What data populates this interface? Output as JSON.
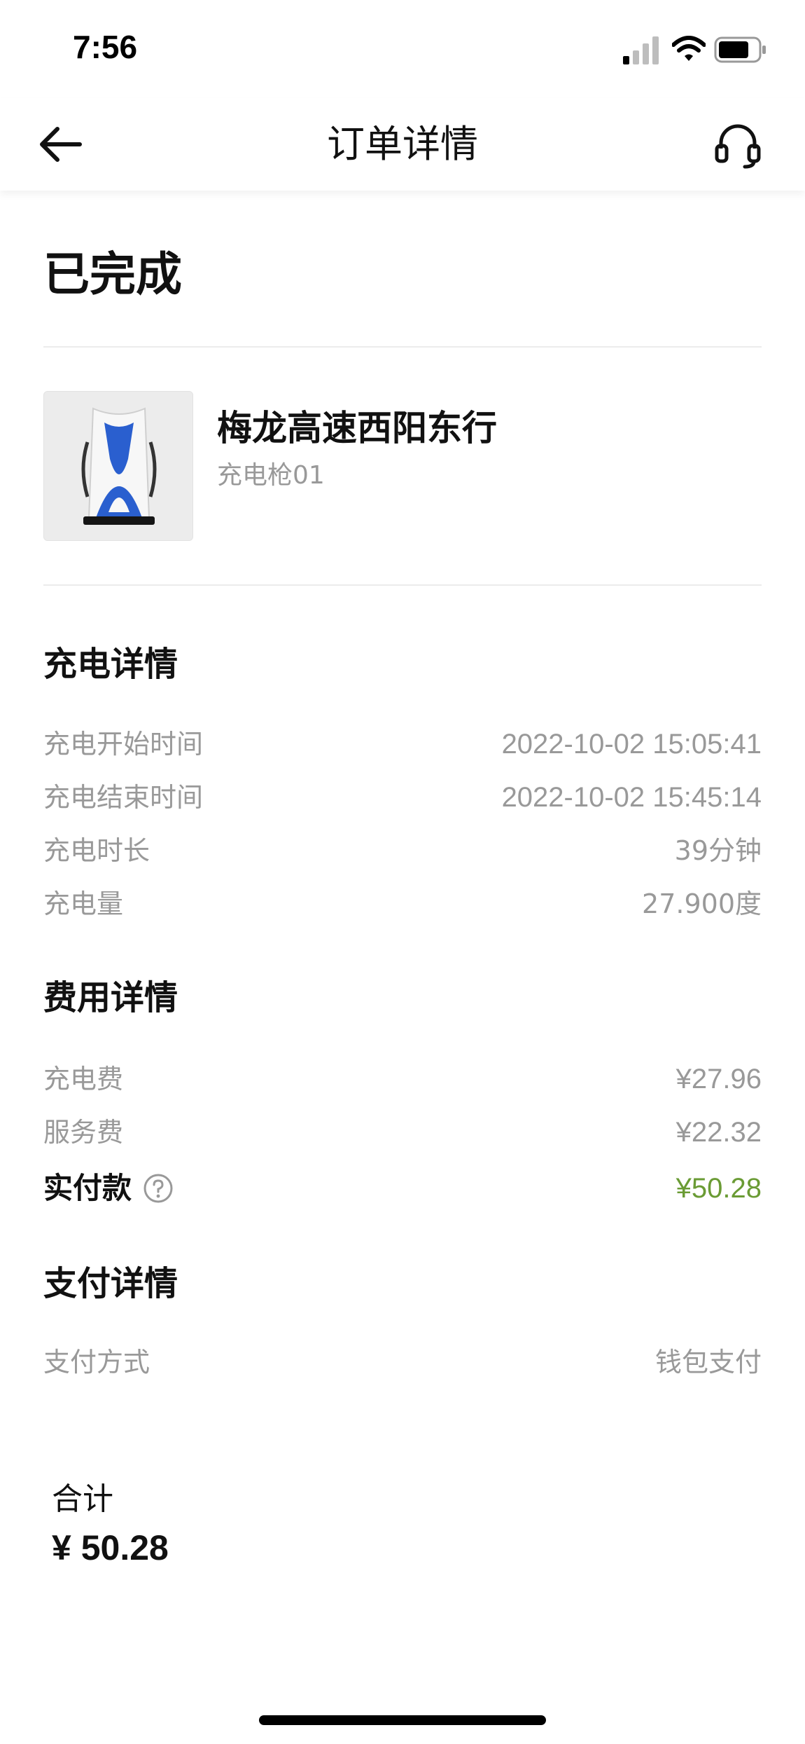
{
  "status_bar": {
    "time": "7:56"
  },
  "nav": {
    "title": "订单详情"
  },
  "order": {
    "status": "已完成"
  },
  "station": {
    "name": "梅龙高速西阳东行",
    "gun": "充电枪01"
  },
  "charging_details": {
    "title": "充电详情",
    "rows": [
      {
        "label": "充电开始时间",
        "value": "2022-10-02 15:05:41"
      },
      {
        "label": "充电结束时间",
        "value": "2022-10-02 15:45:14"
      },
      {
        "label": "充电时长",
        "value": "39分钟"
      },
      {
        "label": "充电量",
        "value": "27.900度"
      }
    ]
  },
  "fee_details": {
    "title": "费用详情",
    "rows": [
      {
        "label": "充电费",
        "value": "¥27.96"
      },
      {
        "label": "服务费",
        "value": "¥22.32"
      }
    ],
    "paid_label": "实付款",
    "paid_value": "¥50.28"
  },
  "payment_details": {
    "title": "支付详情",
    "rows": [
      {
        "label": "支付方式",
        "value": "钱包支付"
      }
    ]
  },
  "total": {
    "label": "合计",
    "amount": "¥ 50.28"
  },
  "colors": {
    "accent_green": "#6a9b34",
    "muted_text": "#999999",
    "primary_text": "#111111",
    "divider": "#ececec",
    "charger_blue": "#2a5fcf"
  },
  "icons": {
    "back": "arrow-left-icon",
    "support": "headset-icon",
    "help": "question-circle-icon",
    "signal": "signal-icon",
    "wifi": "wifi-icon",
    "battery": "battery-icon"
  }
}
